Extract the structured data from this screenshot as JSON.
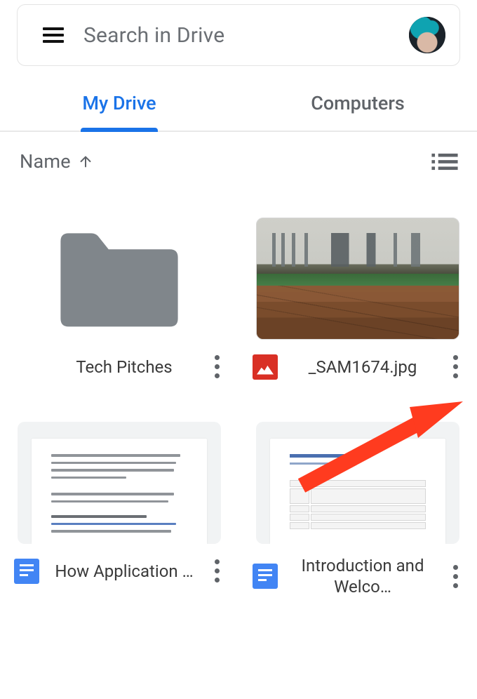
{
  "search": {
    "placeholder": "Search in Drive"
  },
  "tabs": [
    {
      "id": "my-drive",
      "label": "My Drive",
      "active": true
    },
    {
      "id": "computers",
      "label": "Computers",
      "active": false
    }
  ],
  "sort": {
    "label": "Name",
    "direction": "asc"
  },
  "items": [
    {
      "type": "folder",
      "name": "Tech Pitches"
    },
    {
      "type": "image",
      "name": "_SAM1674.jpg",
      "icon": "image"
    },
    {
      "type": "doc",
      "name": "How Application …",
      "icon": "docs"
    },
    {
      "type": "doc",
      "name": "Introduction and Welco…",
      "icon": "docs"
    }
  ],
  "colors": {
    "accent": "#1a73e8",
    "text_secondary": "#5f6368",
    "image_icon": "#d93025",
    "docs_icon": "#4285f4",
    "folder": "#80868b",
    "arrow": "#ff3b1f"
  }
}
